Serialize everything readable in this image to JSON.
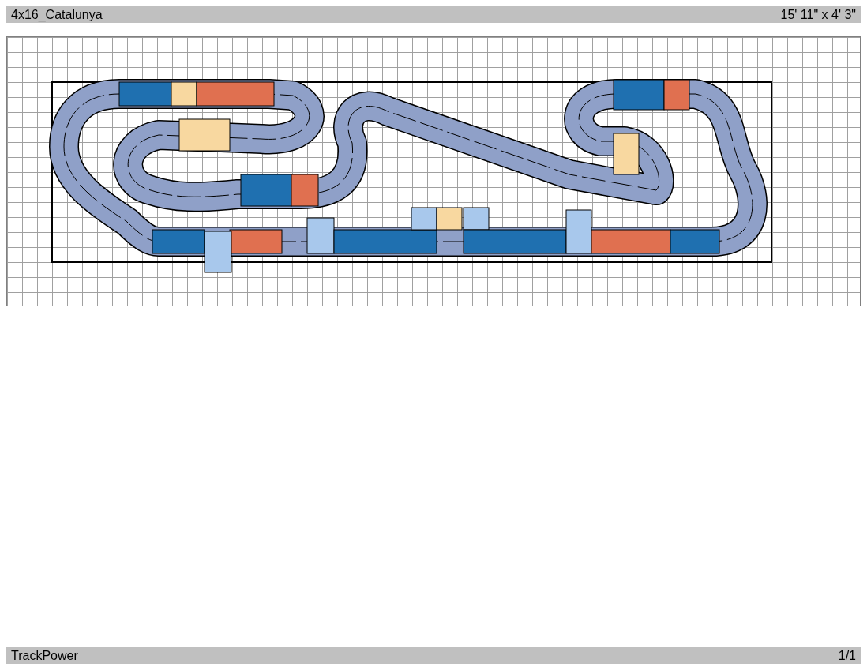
{
  "header": {
    "title": "4x16_Catalunya",
    "dimensions": "15' 11\" x 4' 3\""
  },
  "footer": {
    "app_name": "TrackPower",
    "page": "1/1"
  }
}
